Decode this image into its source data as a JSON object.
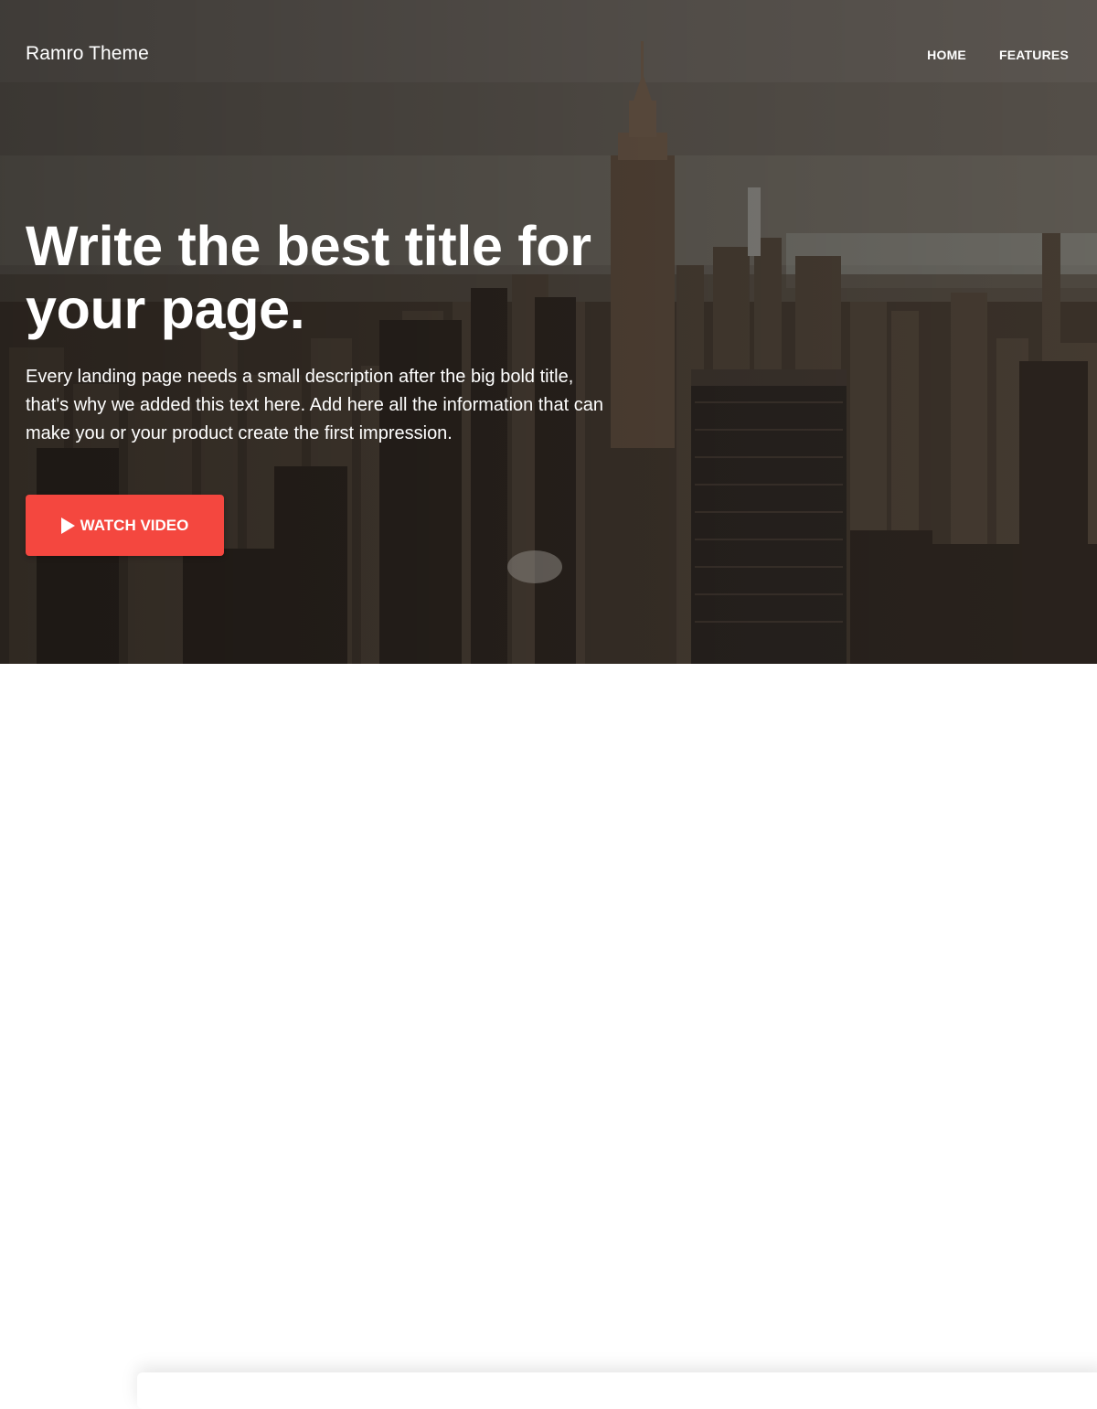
{
  "header": {
    "brand": "Ramro Theme",
    "nav": [
      {
        "label": "HOME"
      },
      {
        "label": "FEATURES"
      }
    ]
  },
  "hero": {
    "title": "Write the best title for your page.",
    "description": "Every landing page needs a small description after the big bold title, that's why we added this text here. Add here all the information that can make you or your product create the first impression.",
    "cta_label": "WATCH VIDEO",
    "cta_icon": "play-icon"
  },
  "colors": {
    "accent": "#f4473f",
    "text_on_hero": "#ffffff"
  }
}
